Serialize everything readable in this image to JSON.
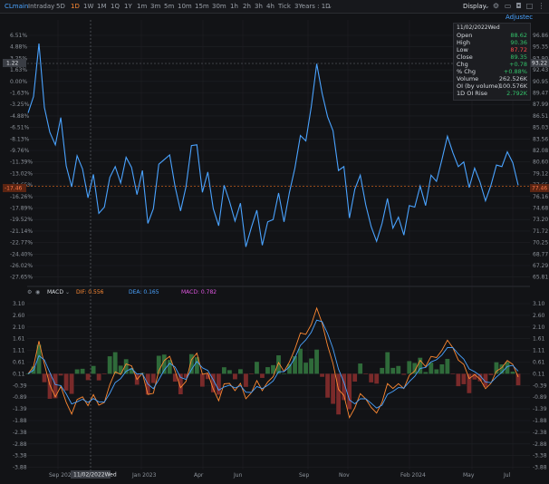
{
  "toolbar": {
    "symbol": "CLmain",
    "timeframes": [
      "Intraday",
      "5D",
      "1D",
      "1W",
      "1M",
      "1Q",
      "1Y",
      "1m",
      "3m",
      "5m",
      "10m",
      "15m",
      "30m",
      "1h",
      "2h",
      "3h",
      "4h",
      "Tick",
      "3Years : 1D"
    ],
    "active_timeframe": "1D",
    "display_label": "Display",
    "adjusted_label": "Adjustec"
  },
  "price_axis": {
    "left_pct_labels": [
      "6.51%",
      "4.88%",
      "3.25%",
      "1.63%",
      "0.00%",
      "-1.63%",
      "-3.25%",
      "-4.88%",
      "-6.51%",
      "-8.13%",
      "-9.76%",
      "-11.39%",
      "-13.02%",
      "-14.65%",
      "-16.26%",
      "-17.89%",
      "-19.52%",
      "-21.14%",
      "-22.77%",
      "-24.40%",
      "-26.02%",
      "-27.65%"
    ],
    "right_price_labels": [
      "96.86",
      "95.35",
      "93.90",
      "92.43",
      "90.95",
      "89.47",
      "87.99",
      "86.51",
      "85.03",
      "83.56",
      "82.08",
      "80.60",
      "79.12",
      "77.65",
      "76.16",
      "74.68",
      "73.20",
      "71.72",
      "70.25",
      "68.77",
      "67.29",
      "65.81"
    ],
    "crosshair_pct": "1.22",
    "crosshair_price": "93.22",
    "last_pct": "-17.46",
    "last_price": "77.46"
  },
  "info_box": {
    "date": "11/02/2022Wed",
    "rows": [
      {
        "label": "Open",
        "value": "88.62",
        "color": "#33c26a"
      },
      {
        "label": "High",
        "value": "90.36",
        "color": "#33c26a"
      },
      {
        "label": "Low",
        "value": "87.72",
        "color": "#ff4a4a"
      },
      {
        "label": "Close",
        "value": "89.35",
        "color": "#33c26a"
      },
      {
        "label": "Chg",
        "value": "+0.78",
        "color": "#33c26a"
      },
      {
        "label": "% Chg",
        "value": "+0.88%",
        "color": "#33c26a"
      },
      {
        "label": "Volume",
        "value": "262.526K",
        "color": "#c9cdd3"
      },
      {
        "label": "OI (by volume)",
        "value": "100.576K",
        "color": "#c9cdd3"
      },
      {
        "label": "1D OI Rise",
        "value": "2.792K",
        "color": "#33c26a"
      }
    ]
  },
  "macd": {
    "title": "MACD",
    "dif_label": "DIF: 0.556",
    "dea_label": "DEA: 0.165",
    "macd_label": "MACD: 0.782",
    "axis_labels": [
      "3.10",
      "2.60",
      "2.10",
      "1.61",
      "1.11",
      "0.61",
      "0.11",
      "-0.39",
      "-0.89",
      "-1.39",
      "-1.88",
      "-2.38",
      "-2.88",
      "-3.38",
      "-3.88"
    ],
    "dif_color": "#ff8a33",
    "dea_color": "#4aa3ff",
    "macd_color": "#e056e0"
  },
  "time_axis": {
    "labels": [
      "Sep 2022",
      "Jan 2023",
      "Apr",
      "Jun",
      "Sep",
      "Nov",
      "Feb 2024",
      "May",
      "Jul"
    ],
    "crosshair_date": "11/02/2022Wed"
  },
  "colors": {
    "price_line": "#4aa3ff",
    "hist_up": "#2f6b3a",
    "hist_down": "#7a2a2a",
    "last_price_line": "#c25a1a"
  },
  "chart_data": {
    "type": "line",
    "series": [
      {
        "values": [
          86.9,
          89.0,
          95.8,
          87.6,
          84.4,
          82.8,
          86.3,
          80.1,
          77.4,
          81.4,
          79.7,
          76.0,
          79.0,
          74.0,
          74.8,
          78.6,
          80.0,
          77.9,
          81.2,
          79.9,
          76.4,
          79.5,
          72.7,
          74.6,
          80.3,
          80.9,
          81.5,
          77.4,
          74.3,
          77.4,
          82.7,
          82.8,
          76.7,
          79.3,
          74.6,
          72.4,
          77.6,
          75.5,
          73.0,
          75.3,
          69.7,
          72.2,
          74.4,
          69.9,
          72.9,
          73.2,
          76.6,
          72.9,
          76.7,
          79.8,
          84.0,
          83.3,
          87.7,
          93.2,
          89.4,
          86.4,
          84.6,
          79.5,
          80.0,
          73.4,
          77.1,
          78.9,
          75.1,
          72.3,
          70.4,
          72.7,
          75.9,
          72.1,
          73.5,
          71.2,
          75.0,
          74.8,
          77.5,
          75.0,
          78.9,
          78.1,
          80.9,
          83.9,
          81.8,
          80.0,
          80.6,
          77.3,
          79.8,
          78.0,
          75.6,
          77.6,
          80.2,
          80.0,
          81.9,
          80.5,
          77.6
        ]
      }
    ]
  }
}
